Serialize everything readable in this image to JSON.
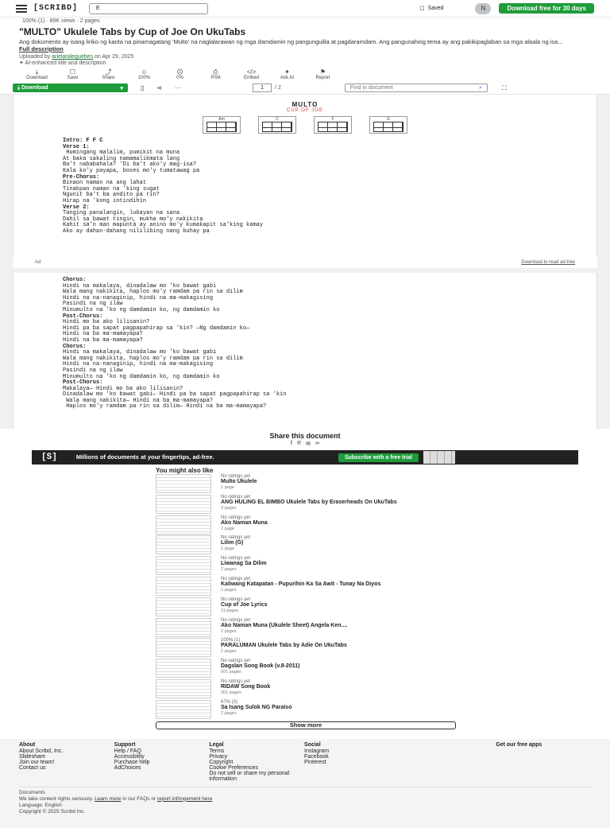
{
  "topbar": {
    "logo": "[SCRIBD]",
    "search_value": "E",
    "saved_label": "Saved",
    "avatar_initial": "N",
    "cta": "Download free for 30 days"
  },
  "doc": {
    "meta": "100% (1) · 89K views · 2 pages",
    "title": "\"MULTO\" Ukulele Tabs by Cup of Joe On UkuTabs",
    "description": "Ang dokumento ay isang liriko ng kanta na pinamagatang 'Multo' na naglalarawan ng mga damdamin ng pangungulila at pagdaramdam. Ang pangunahing tema ay ang pakikipaglaban sa mga alaala ng isa...",
    "full_description": "Full description",
    "uploaded_prefix": "Uploaded by",
    "uploader": "arielaraleguebes",
    "uploaded_date": "on Apr 29, 2025",
    "ai_note": "AI-enhanced title and description"
  },
  "actions": [
    {
      "icon": "download-icon",
      "glyph": "⤓",
      "label": "Download"
    },
    {
      "icon": "bookmark-icon",
      "glyph": "☐",
      "label": "Save"
    },
    {
      "icon": "share-icon",
      "glyph": "⤴",
      "label": "Share"
    },
    {
      "icon": "thumbs-up-icon",
      "glyph": "☺",
      "label": "100%"
    },
    {
      "icon": "thumbs-down-icon",
      "glyph": "☹",
      "label": "0%"
    },
    {
      "icon": "print-icon",
      "glyph": "⎙",
      "label": "Print"
    },
    {
      "icon": "embed-icon",
      "glyph": "</>",
      "label": "Embed"
    },
    {
      "icon": "ask-ai-icon",
      "glyph": "✦",
      "label": "Ask AI"
    },
    {
      "icon": "flag-icon",
      "glyph": "⚑",
      "label": "Report"
    }
  ],
  "toolbar": {
    "download_label": "Download",
    "page_value": "1",
    "page_of": "/ 2",
    "find_placeholder": "Find in document"
  },
  "song": {
    "title": "MULTO",
    "artist": "CUP OF JOE",
    "chord_names": [
      "Am",
      "C",
      "F",
      "G"
    ],
    "page1_lines": [
      {
        "t": "Intro: F F C",
        "b": true
      },
      {
        "t": "Verse 1:",
        "b": true
      },
      {
        "t": " Humingang malalim, pumikit na muna",
        "b": false
      },
      {
        "t": "At baka sakaling namamalikmata lang",
        "b": false
      },
      {
        "t": "Ba't nababahala? 'Di ba't ako'y mag-isa?",
        "b": false
      },
      {
        "t": "Kala ko'y payapa, boses mo'y tumatawag pa",
        "b": false
      },
      {
        "t": "Pre-Chorus:",
        "b": true
      },
      {
        "t": "Binaon naman na ang lahat",
        "b": false
      },
      {
        "t": "Tinakpan naman na 'king sugat",
        "b": false
      },
      {
        "t": "Ngunit ba't ba andito pa rin?",
        "b": false
      },
      {
        "t": "Hirap na 'kong intindihin",
        "b": false
      },
      {
        "t": "Verse 2:",
        "b": true
      },
      {
        "t": "Tanging panalangin, lubayan na sana",
        "b": false
      },
      {
        "t": "Dahil sa bawat tingin, mukha mo'y nakikita",
        "b": false
      },
      {
        "t": "Kahit sa'n man mapunta ay anino mo'y kumakapit sa'king kamay",
        "b": false
      },
      {
        "t": "Ako ay dahan-dahang nililibing nang buhay pa",
        "b": false
      }
    ],
    "page2_lines": [
      {
        "t": "Chorus:",
        "b": true
      },
      {
        "t": "Hindi na makalaya, dinadalaw mo 'ko bawat gabi",
        "b": false
      },
      {
        "t": "Wala mang nakikita, haplos mo'y ramdam pa rin sa dilim",
        "b": false
      },
      {
        "t": "Hindi na na-nanaginip, hindi na ma-makagising",
        "b": false
      },
      {
        "t": "Pasindi na ng ilaw",
        "b": false
      },
      {
        "t": "Minumulto na 'ko ng damdamin ko, ng damdamin ko",
        "b": false
      },
      {
        "t": "Post-Chorus:",
        "b": true
      },
      {
        "t": "Hindi mo ba ako lilisanin?",
        "b": false
      },
      {
        "t": "Hindi pa ba sapat pagpapahirap sa 'kin? —Ng damdamin ko—",
        "b": false
      },
      {
        "t": "Hindi na ba ma-mamayapa?",
        "b": false
      },
      {
        "t": "Hindi na ba ma-mamayapa?",
        "b": false
      },
      {
        "t": "Chorus:",
        "b": true
      },
      {
        "t": "Hindi na makalaya, dinadalaw mo 'ko bawat gabi",
        "b": false
      },
      {
        "t": "Wala mang nakikita, haplos mo'y ramdam pa rin sa dilim",
        "b": false
      },
      {
        "t": "Hindi na na-nanaginip, hindi na ma-makagising",
        "b": false
      },
      {
        "t": "Pasindi na ng ilaw",
        "b": false
      },
      {
        "t": "Minumulto na 'ko ng damdamin ko, ng damdamin ko",
        "b": false
      },
      {
        "t": "Post-Chorus:",
        "b": true
      },
      {
        "t": "Makalaya— Hindi mo ba ako lilisanin?",
        "b": false
      },
      {
        "t": "Dinadalaw mo 'ko bawat gabi— Hindi pa ba sapat pagpapahirap sa 'kin",
        "b": false
      },
      {
        "t": " Wala mang nakikita— Hindi na ba ma-mamayapa?",
        "b": false
      },
      {
        "t": " Haplos mo'y ramdam pa rin sa dilim— Hindi na ba ma-mamayapa?",
        "b": false
      }
    ]
  },
  "ad": {
    "label": "Ad",
    "download_link": "Download to read ad-free"
  },
  "share": {
    "heading": "Share this document"
  },
  "banner": {
    "logo": "[S]",
    "text": "Millions of documents at your fingertips, ad-free.",
    "button": "Subscribe with a free trial"
  },
  "mlt_heading": "You might also like",
  "related": [
    {
      "meta": "No ratings yet",
      "title": "Multo Ukulele",
      "pages": "1 page"
    },
    {
      "meta": "No ratings yet",
      "title": "ANG HULING EL BIMBO Ukulele Tabs by Eraserheads On UkuTabs",
      "pages": "3 pages"
    },
    {
      "meta": "No ratings yet",
      "title": "Ako Naman Muna",
      "pages": "1 page"
    },
    {
      "meta": "No ratings yet",
      "title": "Lilim (G)",
      "pages": "1 page"
    },
    {
      "meta": "No ratings yet",
      "title": "Liwanag Sa Dilim",
      "pages": "2 pages"
    },
    {
      "meta": "No ratings yet",
      "title": "Kaliwang Katapatan - Pupurihin Ka Sa Awit - Tunay Na Diyos",
      "pages": "2 pages"
    },
    {
      "meta": "No ratings yet",
      "title": "Cup of Joe Lyrics",
      "pages": "11 pages"
    },
    {
      "meta": "No ratings yet",
      "title": "Ako Naman Muna (Ukulele Sheet) Angela Ken....",
      "pages": "2 pages"
    },
    {
      "meta": "100% (1)",
      "title": "PARALUMAN Ukulele Tabs by Adie On UkuTabs",
      "pages": "2 pages"
    },
    {
      "meta": "No ratings yet",
      "title": "Dagslan Song Book (v.8-2011)",
      "pages": "601 pages"
    },
    {
      "meta": "No ratings yet",
      "title": "RIDAW Song Book",
      "pages": "201 pages"
    },
    {
      "meta": "67% (3)",
      "title": "Sa Isang Sulok NG Paraiso",
      "pages": "2 pages"
    }
  ],
  "show_more": "Show more",
  "footer": {
    "cols": [
      {
        "heading": "About",
        "items": [
          "About Scribd, Inc.",
          "Slideshare",
          "Join our team!",
          "Contact us"
        ]
      },
      {
        "heading": "Support",
        "items": [
          "Help / FAQ",
          "Accessibility",
          "Purchase help",
          "AdChoices"
        ]
      },
      {
        "heading": "Legal",
        "items": [
          "Terms",
          "Privacy",
          "Copyright",
          "Cookie Preferences",
          "Do not sell or share my personal information"
        ]
      },
      {
        "heading": "Social",
        "items": [
          "Instagram",
          "Facebook",
          "Pinterest"
        ]
      },
      {
        "heading": "Get our free apps",
        "items": []
      }
    ],
    "documents": "Documents",
    "rights_1": "We take content rights seriously.",
    "learn_more": "Learn more",
    "rights_2": "in our FAQs or",
    "report": "report infringement here",
    "language": "Language: English",
    "copyright": "Copyright © 2025 Scribd Inc."
  }
}
